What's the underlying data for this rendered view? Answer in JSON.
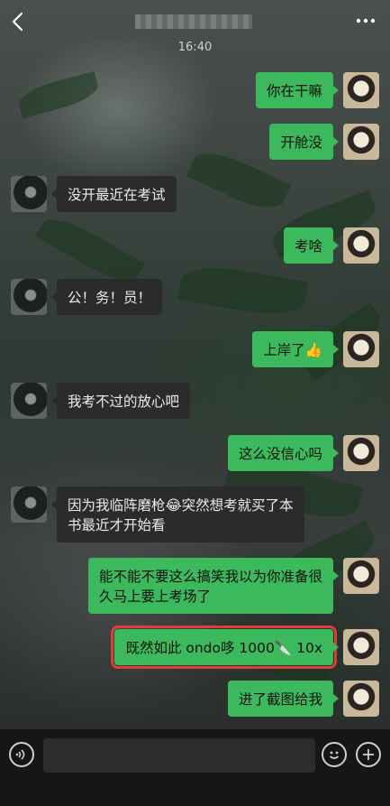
{
  "header": {
    "back_icon": "chevron-left-icon",
    "more_icon": "more-dots-icon"
  },
  "timestamp": "16:40",
  "messages": [
    {
      "side": "self",
      "text": "你在干嘛"
    },
    {
      "side": "self",
      "text": "开舱没"
    },
    {
      "side": "other",
      "text": "没开最近在考试"
    },
    {
      "side": "self",
      "text": "考啥"
    },
    {
      "side": "other",
      "text": "公！务！员！"
    },
    {
      "side": "self",
      "text": "上岸了👍"
    },
    {
      "side": "other",
      "text": "我考不过的放心吧"
    },
    {
      "side": "self",
      "text": "这么没信心吗"
    },
    {
      "side": "other",
      "text": "因为我临阵磨枪😂突然想考就买了本\n书最近才开始看"
    },
    {
      "side": "self",
      "text": "能不能不要这么搞笑我以为你准备很\n久马上要上考场了"
    },
    {
      "side": "self",
      "text": "既然如此 ondo哆 1000🔪 10x"
    },
    {
      "side": "self",
      "text": "进了截图给我"
    }
  ],
  "input_bar": {
    "voice_icon": "voice-icon",
    "emoji_icon": "emoji-icon",
    "plus_icon": "plus-icon",
    "placeholder": ""
  },
  "colors": {
    "self_bubble": "#3cb95c",
    "other_bubble": "#2b2b2b",
    "highlight_border": "#e03c3c"
  }
}
